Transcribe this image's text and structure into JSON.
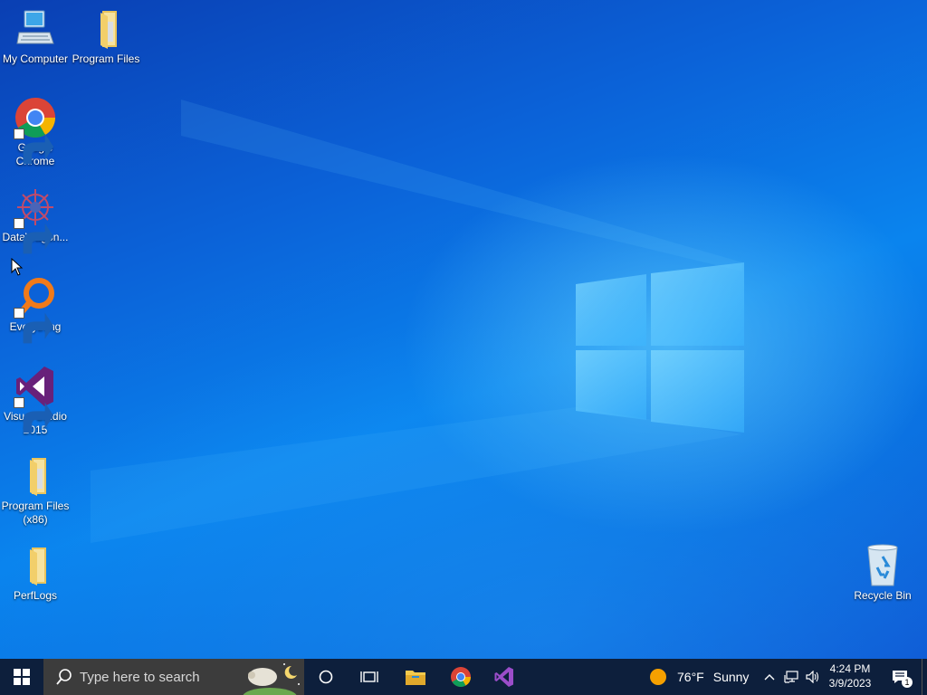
{
  "desktop": {
    "icons": [
      {
        "label": "My Computer",
        "icon": "computer-icon"
      },
      {
        "label": "Program Files",
        "icon": "folder-icon"
      },
      {
        "label": "Google Chrome",
        "icon": "chrome-icon"
      },
      {
        "label": "DataWagon...",
        "icon": "datawagon-icon"
      },
      {
        "label": "Everything",
        "icon": "everything-search-icon"
      },
      {
        "label": "Visual Studio 2015",
        "icon": "visual-studio-icon"
      },
      {
        "label": "Program Files (x86)",
        "icon": "folder-icon"
      },
      {
        "label": "PerfLogs",
        "icon": "folder-icon"
      },
      {
        "label": "Recycle Bin",
        "icon": "recycle-bin-icon"
      }
    ]
  },
  "taskbar": {
    "search_placeholder": "Type here to search",
    "pinned": [
      "file-explorer-icon",
      "chrome-icon",
      "visual-studio-icon"
    ],
    "weather": {
      "temp": "76°F",
      "condition": "Sunny"
    },
    "clock": {
      "time": "4:24 PM",
      "date": "3/9/2023"
    },
    "notification_count": "1"
  },
  "colors": {
    "taskbar_bg": "#0d1f3c",
    "search_bg": "#3c3c3c",
    "desktop_blue": "#0a84ee"
  }
}
